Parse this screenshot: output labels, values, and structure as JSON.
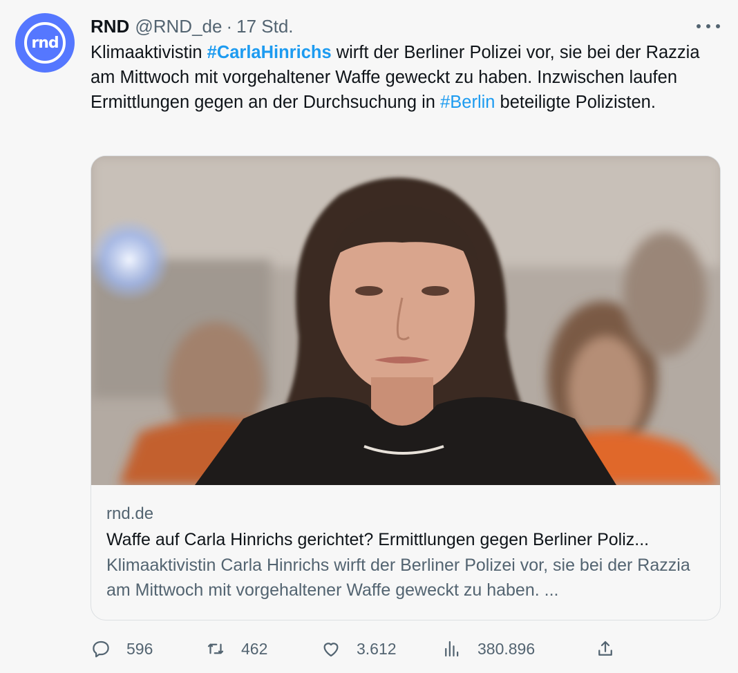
{
  "tweet": {
    "display_name": "RND",
    "handle": "@RND_de",
    "separator": "·",
    "time": "17 Std.",
    "avatar_text": "rnd",
    "text": {
      "part1": "Klimaaktivistin ",
      "hashtag1": "#CarlaHinrichs",
      "part2": " wirft der Berliner Polizei vor, sie bei der Razzia am Mittwoch mit vorgehaltener Waffe geweckt zu haben. Inzwischen laufen Ermittlungen gegen an der Durchsuchung in ",
      "hashtag2": "#Berlin",
      "part3": " beteiligte Polizisten."
    }
  },
  "card": {
    "domain": "rnd.de",
    "title": "Waffe auf Carla Hinrichs gerichtet? Ermittlungen gegen Berliner Poliz...",
    "description": "Klimaaktivistin Carla Hinrichs wirft der Berliner Polizei vor, sie bei der Razzia am Mittwoch mit vorgehaltener Waffe geweckt zu haben. ..."
  },
  "actions": {
    "reply_count": "596",
    "retweet_count": "462",
    "like_count": "3.612",
    "views_count": "380.896"
  },
  "icons": {
    "more": "more-horizontal-icon",
    "reply": "reply-icon",
    "retweet": "retweet-icon",
    "like": "heart-icon",
    "views": "views-icon",
    "share": "share-icon"
  },
  "colors": {
    "link": "#1d9bf0",
    "secondary_text": "#536471",
    "avatar_bg": "#5577ff"
  }
}
